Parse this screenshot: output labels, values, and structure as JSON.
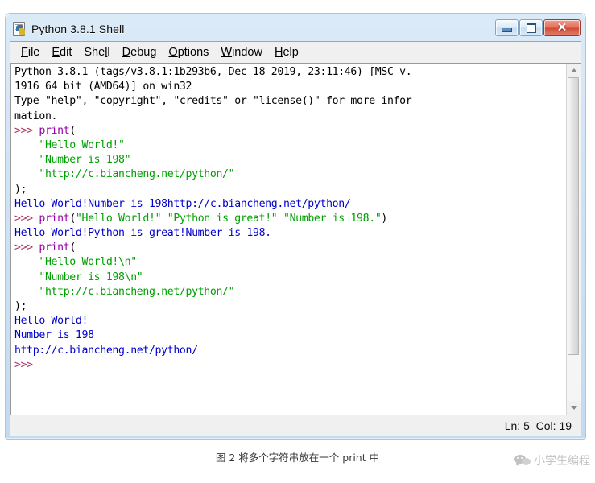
{
  "window": {
    "title": "Python 3.8.1 Shell",
    "icon": "python-file-icon",
    "controls": {
      "minimize": "Minimize",
      "maximize": "Maximize",
      "close": "Close"
    }
  },
  "menubar": {
    "items": [
      {
        "label": "File",
        "accel": "F"
      },
      {
        "label": "Edit",
        "accel": "E"
      },
      {
        "label": "Shell",
        "accel": "l"
      },
      {
        "label": "Debug",
        "accel": "D"
      },
      {
        "label": "Options",
        "accel": "O"
      },
      {
        "label": "Window",
        "accel": "W"
      },
      {
        "label": "Help",
        "accel": "H"
      }
    ]
  },
  "console": {
    "lines": [
      [
        {
          "t": "Python 3.8.1 (tags/v3.8.1:1b293b6, Dec 18 2019, 23:11:46) [MSC v.",
          "c": "black"
        }
      ],
      [
        {
          "t": "1916 64 bit (AMD64)] on win32",
          "c": "black"
        }
      ],
      [
        {
          "t": "Type \"help\", \"copyright\", \"credits\" or \"license()\" for more infor",
          "c": "black"
        }
      ],
      [
        {
          "t": "mation.",
          "c": "black"
        }
      ],
      [
        {
          "t": ">>> ",
          "c": "prompt"
        },
        {
          "t": "print",
          "c": "keyword"
        },
        {
          "t": "(",
          "c": "black"
        }
      ],
      [
        {
          "t": "    ",
          "c": "black"
        },
        {
          "t": "\"Hello World!\"",
          "c": "string"
        }
      ],
      [
        {
          "t": "    ",
          "c": "black"
        },
        {
          "t": "\"Number is 198\"",
          "c": "string"
        }
      ],
      [
        {
          "t": "    ",
          "c": "black"
        },
        {
          "t": "\"http://c.biancheng.net/python/\"",
          "c": "string"
        }
      ],
      [
        {
          "t": ");",
          "c": "black"
        }
      ],
      [
        {
          "t": "Hello World!Number is 198http://c.biancheng.net/python/",
          "c": "output"
        }
      ],
      [
        {
          "t": ">>> ",
          "c": "prompt"
        },
        {
          "t": "print",
          "c": "keyword"
        },
        {
          "t": "(",
          "c": "black"
        },
        {
          "t": "\"Hello World!\"",
          "c": "string"
        },
        {
          "t": " ",
          "c": "black"
        },
        {
          "t": "\"Python is great!\"",
          "c": "string"
        },
        {
          "t": " ",
          "c": "black"
        },
        {
          "t": "\"Number is 198.\"",
          "c": "string"
        },
        {
          "t": ")",
          "c": "black"
        }
      ],
      [
        {
          "t": "Hello World!Python is great!Number is 198.",
          "c": "output"
        }
      ],
      [
        {
          "t": ">>> ",
          "c": "prompt"
        },
        {
          "t": "print",
          "c": "keyword"
        },
        {
          "t": "(",
          "c": "black"
        }
      ],
      [
        {
          "t": "    ",
          "c": "black"
        },
        {
          "t": "\"Hello World!\\n\"",
          "c": "string"
        }
      ],
      [
        {
          "t": "    ",
          "c": "black"
        },
        {
          "t": "\"Number is 198\\n\"",
          "c": "string"
        }
      ],
      [
        {
          "t": "    ",
          "c": "black"
        },
        {
          "t": "\"http://c.biancheng.net/python/\"",
          "c": "string"
        }
      ],
      [
        {
          "t": ");",
          "c": "black"
        }
      ],
      [
        {
          "t": "Hello World!",
          "c": "output"
        }
      ],
      [
        {
          "t": "Number is 198",
          "c": "output"
        }
      ],
      [
        {
          "t": "http://c.biancheng.net/python/",
          "c": "output"
        }
      ],
      [
        {
          "t": ">>>",
          "c": "prompt"
        }
      ]
    ],
    "colors": {
      "black": "#000000",
      "prompt": "#b03060",
      "keyword": "#9900aa",
      "string": "#00a000",
      "output": "#0000cc"
    }
  },
  "scrollbar": {
    "up_arrow": "scroll-up-arrow",
    "down_arrow": "scroll-down-arrow"
  },
  "statusbar": {
    "position": "Ln: 5  Col: 19"
  },
  "caption": "图 2 将多个字符串放在一个 print 中",
  "watermark": {
    "text": "小学生编程",
    "icon": "wechat-icon"
  }
}
